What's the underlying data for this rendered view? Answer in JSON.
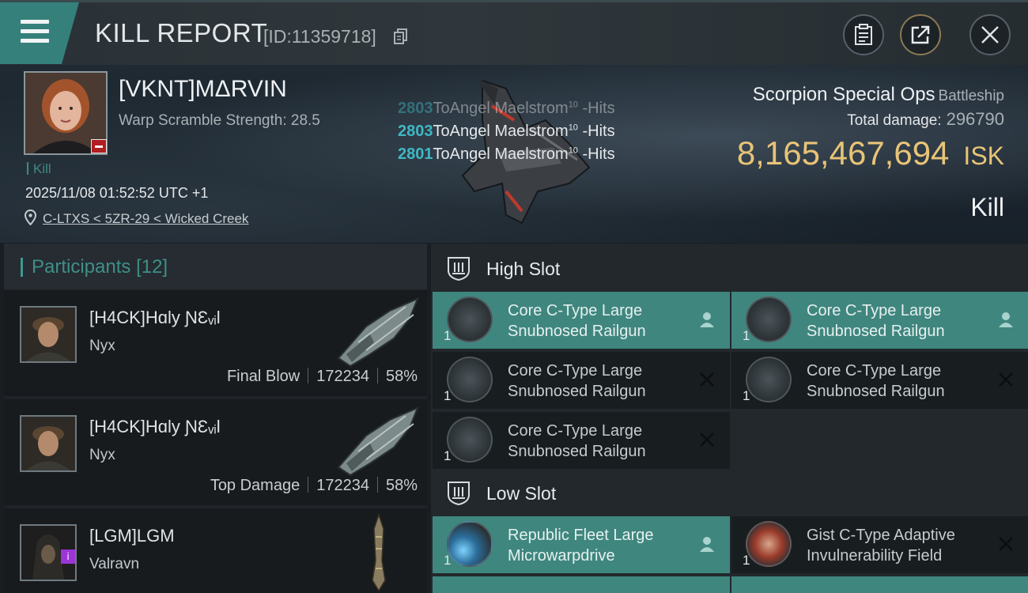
{
  "header": {
    "title": "KILL REPORT",
    "report_id": "[ID:11359718]",
    "icons": [
      "menu-icon",
      "copy-icon",
      "clipboard-icon",
      "share-icon",
      "close-icon"
    ]
  },
  "victim": {
    "name": "[VKNT]MΔRVIN",
    "warp_scramble": "Warp Scramble Strength: 28.5",
    "tag": "Kill",
    "timestamp": "2025/11/08 01:52:52 UTC +1",
    "location": "C-LTXS < 5ZR-29 < Wicked Creek",
    "ship_name": "Scorpion Special Ops",
    "ship_class": "Battleship",
    "total_damage_label": "Total damage:",
    "total_damage": "296790",
    "isk_value": "8,165,467,694",
    "isk_unit": "ISK",
    "result": "Kill"
  },
  "hits": [
    {
      "count": "2803",
      "text": "ToAngel Maelstrom",
      "sup": "10",
      "suffix": " -Hits"
    },
    {
      "count": "2803",
      "text": "ToAngel Maelstrom",
      "sup": "10",
      "suffix": " -Hits"
    },
    {
      "count": "2801",
      "text": "ToAngel Maelstrom",
      "sup": "10",
      "suffix": " -Hits"
    }
  ],
  "participants": {
    "label": "Participants",
    "count": "[12]",
    "items": [
      {
        "name": "[H4CK]Hɑly ƝƐᵥᵢl",
        "ship": "Nyx",
        "role": "Final Blow",
        "damage": "172234",
        "percent": "58%"
      },
      {
        "name": "[H4CK]Hɑly ƝƐᵥᵢl",
        "ship": "Nyx",
        "role": "Top Damage",
        "damage": "172234",
        "percent": "58%"
      },
      {
        "name": "[LGM]LGM",
        "ship": "Valravn",
        "role": "",
        "damage": "",
        "percent": ""
      }
    ]
  },
  "slots": {
    "high": {
      "label": "High Slot",
      "modules": [
        {
          "name": "Core C-Type Large Snubnosed Railgun",
          "qty": "1",
          "state": "person-icon",
          "active": true
        },
        {
          "name": "Core C-Type Large Snubnosed Railgun",
          "qty": "1",
          "state": "person-icon",
          "active": true
        },
        {
          "name": "Core C-Type Large Snubnosed Railgun",
          "qty": "1",
          "state": "x-icon",
          "active": false
        },
        {
          "name": "Core C-Type Large Snubnosed Railgun",
          "qty": "1",
          "state": "x-icon",
          "active": false
        },
        {
          "name": "Core C-Type Large Snubnosed Railgun",
          "qty": "1",
          "state": "x-icon",
          "active": false
        }
      ]
    },
    "low": {
      "label": "Low Slot",
      "modules": [
        {
          "name": "Republic Fleet Large Microwarpdrive",
          "qty": "1",
          "state": "person-icon",
          "active": true
        },
        {
          "name": "Gist C-Type Adaptive Invulnerability Field",
          "qty": "1",
          "state": "x-icon",
          "active": false
        }
      ]
    }
  },
  "colors": {
    "accent": "#3f867f",
    "isk": "#e8c477",
    "hit_count": "#3fb8c4"
  }
}
